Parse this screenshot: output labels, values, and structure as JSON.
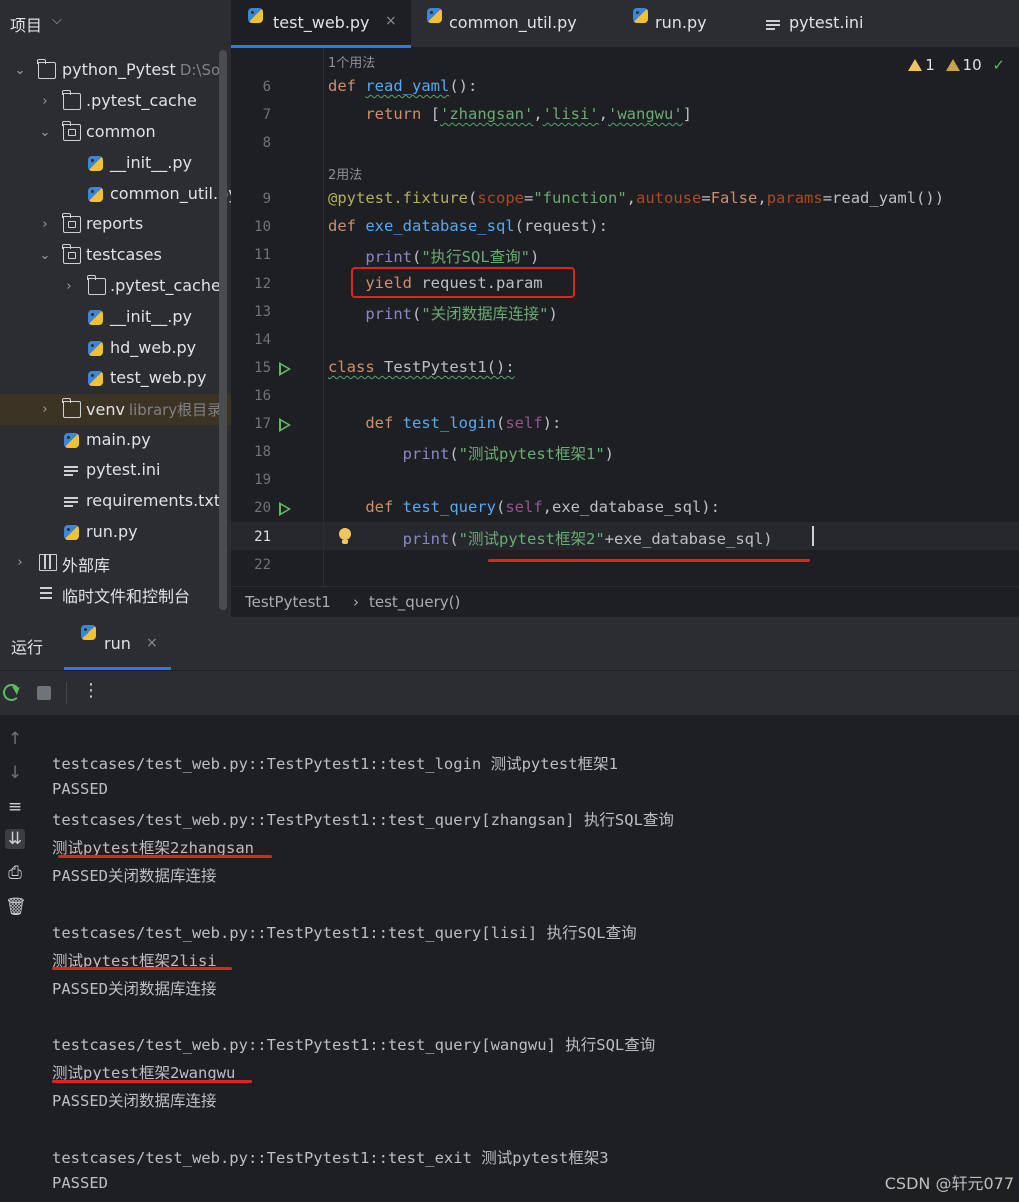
{
  "project_panel": {
    "title": "项目",
    "root_name": "python_Pytest",
    "root_path": "D:\\So",
    "items": [
      {
        "label": ".pytest_cache"
      },
      {
        "label": "common"
      },
      {
        "label": "__init__.py"
      },
      {
        "label": "common_util.py"
      },
      {
        "label": "reports"
      },
      {
        "label": "testcases"
      },
      {
        "label": ".pytest_cache"
      },
      {
        "label": "__init__.py"
      },
      {
        "label": "hd_web.py"
      },
      {
        "label": "test_web.py"
      },
      {
        "label": "venv",
        "hint": "library根目录"
      },
      {
        "label": "main.py"
      },
      {
        "label": "pytest.ini"
      },
      {
        "label": "requirements.txt"
      },
      {
        "label": "run.py"
      },
      {
        "label": "外部库"
      },
      {
        "label": "临时文件和控制台"
      }
    ]
  },
  "tabs": [
    {
      "label": "test_web.py",
      "close": "×"
    },
    {
      "label": "common_util.py"
    },
    {
      "label": "run.py"
    },
    {
      "label": "pytest.ini"
    }
  ],
  "editor": {
    "usage_hint_1": "1个用法",
    "usage_hint_2": "2用法",
    "warnings": {
      "w1": "1",
      "w2": "10"
    },
    "line_numbers": [
      "6",
      "7",
      "8",
      "9",
      "10",
      "11",
      "12",
      "13",
      "14",
      "15",
      "16",
      "17",
      "18",
      "19",
      "20",
      "21",
      "22"
    ],
    "code": {
      "l6_def": "def ",
      "l6_fn": "read_yaml",
      "l6_rest": "():",
      "l7_kw": "return ",
      "l7_a": "[",
      "l7_s1": "'zhangsan'",
      "l7_c1": ",",
      "l7_s2": "'lisi'",
      "l7_c2": ",",
      "l7_s3": "'wangwu'",
      "l7_b": "]",
      "l9_dec": "@pytest.fixture",
      "l9_p": "(",
      "l9_k1": "scope",
      "l9_eq1": "=",
      "l9_v1": "\"function\"",
      "l9_c1": ",",
      "l9_k2": "autouse",
      "l9_eq2": "=",
      "l9_v2": "False",
      "l9_c2": ",",
      "l9_k3": "params",
      "l9_eq3": "=",
      "l9_v3": "read_yaml())",
      "l10_def": "def ",
      "l10_fn": "exe_database_sql",
      "l10_rest": "(request):",
      "l11_pr": "print",
      "l11_a": "(",
      "l11_s": "\"执行SQL查询\"",
      "l11_b": ")",
      "l12_kw": "yield ",
      "l12_rest": "request.param",
      "l13_pr": "print",
      "l13_a": "(",
      "l13_s": "\"关闭数据库连接\"",
      "l13_b": ")",
      "l15_kw": "class ",
      "l15_rest": "TestPytest1():",
      "l17_def": "def ",
      "l17_fn": "test_login",
      "l17_a": "(",
      "l17_self": "self",
      "l17_b": "):",
      "l18_pr": "print",
      "l18_a": "(",
      "l18_s": "\"测试pytest框架1\"",
      "l18_b": ")",
      "l20_def": "def ",
      "l20_fn": "test_query",
      "l20_a": "(",
      "l20_self": "self",
      "l20_b": ",exe_database_sql):",
      "l21_pr": "print",
      "l21_a": "(",
      "l21_s": "\"测试pytest框架2\"",
      "l21_b": "+exe_database_sql)"
    }
  },
  "breadcrumb": {
    "class": "TestPytest1",
    "sep": "›",
    "method": "test_query()"
  },
  "run_panel": {
    "title": "运行",
    "tab_label": "run",
    "tab_close": "×",
    "more": "⋮",
    "output": [
      "testcases/test_web.py::TestPytest1::test_login 测试pytest框架1",
      "PASSED",
      "testcases/test_web.py::TestPytest1::test_query[zhangsan] 执行SQL查询",
      "测试pytest框架2zhangsan",
      "PASSED关闭数据库连接",
      "testcases/test_web.py::TestPytest1::test_query[lisi] 执行SQL查询",
      "测试pytest框架2lisi",
      "PASSED关闭数据库连接",
      "testcases/test_web.py::TestPytest1::test_query[wangwu] 执行SQL查询",
      "测试pytest框架2wangwu",
      "PASSED关闭数据库连接",
      "testcases/test_web.py::TestPytest1::test_exit 测试pytest框架3",
      "PASSED"
    ]
  },
  "watermark": "CSDN @轩元077",
  "colors": {
    "accent": "#3574f0",
    "annotation_red": "#e02424",
    "run_green": "#5fb865"
  }
}
